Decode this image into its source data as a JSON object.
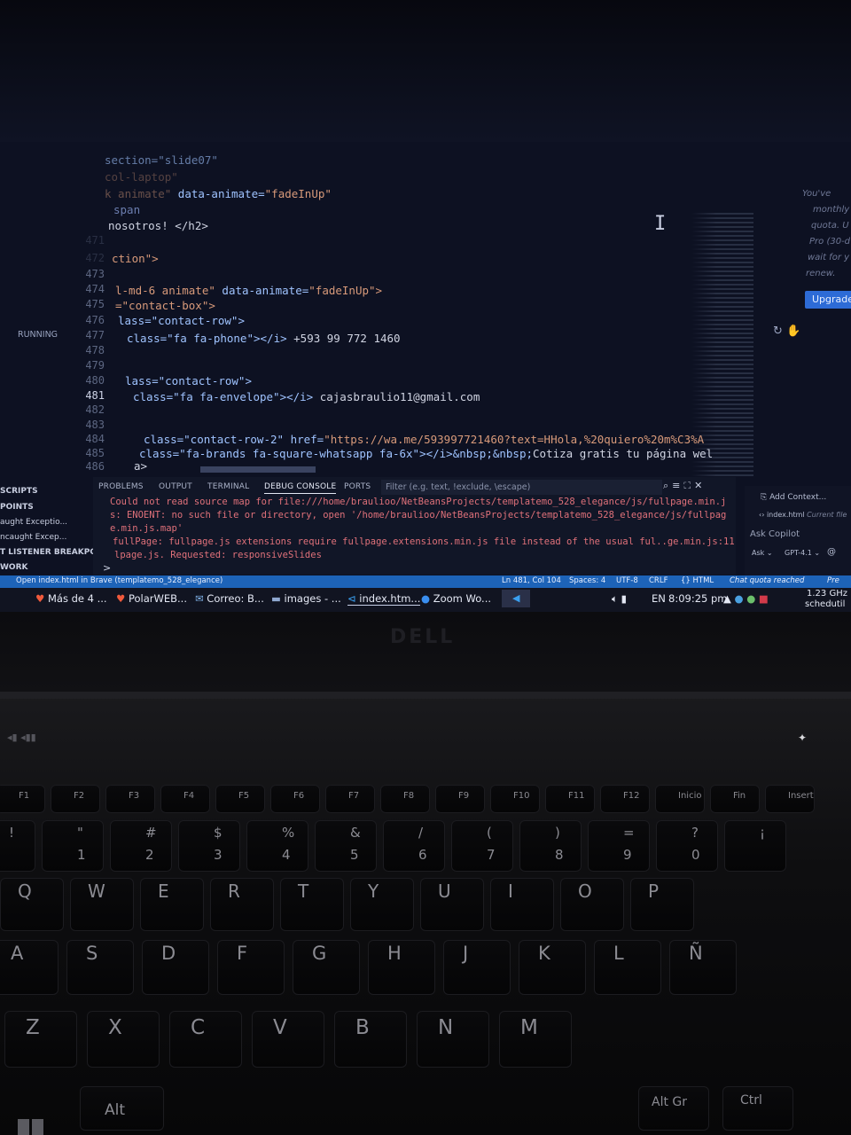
{
  "editor": {
    "line_numbers": [
      "471",
      "472",
      "473",
      "474",
      "475",
      "476",
      "477",
      "478",
      "479",
      "480",
      "481",
      "482",
      "483",
      "484",
      "485",
      "486"
    ],
    "current_line": "481",
    "lines": {
      "l0": "section=\"slide07\"",
      "l1": "col-laptop\"",
      "l2a": "k animate\" ",
      "l2b": "data-animate=",
      "l2c": "\"fadeInUp\"",
      "l3": "span",
      "l4": "nosotros! </h2>",
      "l5": "ction\">",
      "l6a": "l-md-6 animate\" ",
      "l6b": "data-animate=",
      "l6c": "\"fadeInUp\">",
      "l7": "=\"contact-box\">",
      "l8": "lass=\"contact-row\">",
      "l9a": "class=\"fa fa-phone\"></i>",
      "l9b": " +593 99 772 1460",
      "l10": "lass=\"contact-row\">",
      "l11a": "class=\"fa fa-envelope\"></i>",
      "l11b": " cajasbraulio11@gmail.com",
      "l12a": "class=\"contact-row-2\" href=",
      "l12b": "\"https://wa.me/593997721460?text=HHola,%20quiero%20m%C3%A",
      "l13a": "class=\"fa-brands fa-square-whatsapp fa-6x\"></i>&nbsp;&nbsp;",
      "l13b": "Cotiza gratis tu página wel",
      "l14": "a>"
    }
  },
  "run_status": "RUNNING",
  "copilot": {
    "lines": [
      "You've",
      "monthly",
      "quota. U",
      "Pro (30-d",
      "wait for y",
      "renew."
    ],
    "upgrade_label": "Upgrade",
    "add_context": "Add Context...",
    "file_chip": "index.html",
    "file_chip_note": "Current file",
    "ask_placeholder": "Ask Copilot",
    "mode": "Ask",
    "model": "GPT-4.1",
    "at": "@"
  },
  "sidebar": [
    "SCRIPTS",
    "POINTS",
    "aught Exceptio...",
    "ncaught Excep...",
    "T LISTENER BREAKPO...",
    "WORK"
  ],
  "panel": {
    "tabs": [
      "PROBLEMS",
      "OUTPUT",
      "TERMINAL",
      "DEBUG CONSOLE",
      "PORTS"
    ],
    "active_tab": "DEBUG CONSOLE",
    "filter_placeholder": "Filter (e.g. text, !exclude, \\escape)",
    "errors": [
      "Could not read source map for file:///home/braulioo/NetBeansProjects/templatemo_528_elegance/js/fullpage.min.j",
      "s: ENOENT: no such file or directory, open '/home/braulioo/NetBeansProjects/templatemo_528_elegance/js/fullpag",
      "e.min.js.map'",
      "fullPage: fullpage.js extensions require fullpage.extensions.min.js file instead of the usual ful..ge.min.js:11",
      "lpage.js. Requested: responsiveSlides"
    ],
    "prompt": ">"
  },
  "statusbar": {
    "open_in_brave": "Open index.html in Brave (templatemo_528_elegance)",
    "position": "Ln 481, Col 104",
    "spaces": "Spaces: 4",
    "encoding": "UTF-8",
    "eol": "CRLF",
    "language": "{} HTML",
    "copilot_quota": "Chat quota reached",
    "pre": "Pre"
  },
  "taskbar": {
    "items": [
      "Más de 4 ...",
      "PolarWEB...",
      "Correo: B...",
      "images - ...",
      "index.htm...",
      "Zoom Wo..."
    ],
    "lang": "EN",
    "time": "8:09:25 pm",
    "cpu": "1.23 GHz",
    "cpu2": "schedutil"
  },
  "laptop": {
    "brand": "DELL",
    "fkeys": [
      "F1",
      "F2",
      "F3",
      "F4",
      "F5",
      "F6",
      "F7",
      "F8",
      "F9",
      "F10",
      "F11",
      "F12",
      "Inicio",
      "Fin",
      "Insert"
    ],
    "row_num": [
      "!",
      "\"",
      "#",
      "$",
      "%",
      "&",
      "/",
      "(",
      ")",
      "=",
      "?",
      "¡"
    ],
    "row_num_low": [
      "1",
      "2",
      "3",
      "4",
      "5",
      "6",
      "7",
      "8",
      "9",
      "0"
    ],
    "row_q": [
      "Q",
      "W",
      "E",
      "R",
      "T",
      "Y",
      "U",
      "I",
      "O",
      "P"
    ],
    "row_a": [
      "A",
      "S",
      "D",
      "F",
      "G",
      "H",
      "J",
      "K",
      "L",
      "Ñ"
    ],
    "row_z": [
      "Z",
      "X",
      "C",
      "V",
      "B",
      "N",
      "M"
    ],
    "alt": "Alt",
    "altgr": "Alt Gr",
    "ctrl": "Ctrl"
  }
}
